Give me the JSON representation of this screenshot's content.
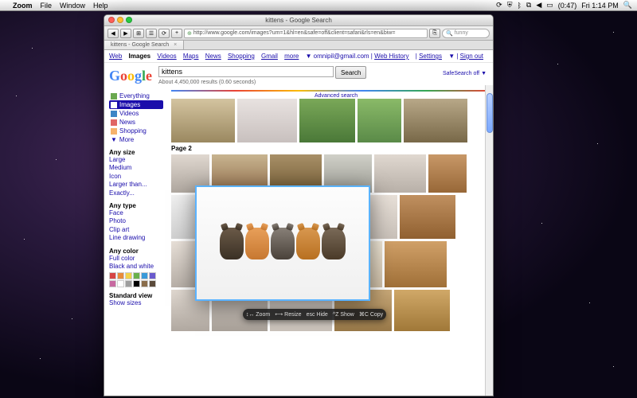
{
  "menubar": {
    "app": "Zoom",
    "items": [
      "File",
      "Window",
      "Help"
    ],
    "time": "Fri 1:14 PM",
    "battery": "(0:47)"
  },
  "browser": {
    "title": "kittens - Google Search",
    "url": "http://www.google.com/images?um=1&hl=en&safe=off&client=safari&rls=en&biw=",
    "search_placeholder": "funny",
    "tab": "kittens - Google Search"
  },
  "google": {
    "topnav": [
      "Web",
      "Images",
      "Videos",
      "Maps",
      "News",
      "Shopping",
      "Gmail",
      "more"
    ],
    "topnav_active": "Images",
    "account": "omnipil@gmail.com",
    "topright": [
      "Web History",
      "Settings",
      "Sign out"
    ],
    "query": "kittens",
    "search_btn": "Search",
    "stats": "About 4,450,000 results (0.60 seconds)",
    "advanced": "Advanced search",
    "safesearch": "SafeSearch off",
    "side_cats": [
      {
        "label": "Everything",
        "color": "#6aa84f"
      },
      {
        "label": "Images",
        "color": "#3d85c6",
        "selected": true
      },
      {
        "label": "Videos",
        "color": "#3d85c6"
      },
      {
        "label": "News",
        "color": "#e06666"
      },
      {
        "label": "Shopping",
        "color": "#f6b26b"
      },
      {
        "label": "More",
        "color": "#888"
      }
    ],
    "filters": {
      "size_h": "Any size",
      "sizes": [
        "Large",
        "Medium",
        "Icon",
        "Larger than...",
        "Exactly..."
      ],
      "type_h": "Any type",
      "types": [
        "Face",
        "Photo",
        "Clip art",
        "Line drawing"
      ],
      "color_h": "Any color",
      "colors": [
        "Full color",
        "Black and white"
      ],
      "swatches": [
        "#d64545",
        "#e88c3c",
        "#f2d34b",
        "#6ab04c",
        "#3a9ad9",
        "#6a5acd",
        "#c769a0",
        "#ffffff",
        "#9e9e9e",
        "#000000",
        "#8a6d4b",
        "#5a4a3a"
      ],
      "view_h": "Standard view",
      "view_opt": "Show sizes"
    },
    "page2": "Page 2"
  },
  "zoom_toolbar": {
    "zoom": "Zoom",
    "resize": "Resize",
    "hide": "esc Hide",
    "show": "^Z Show",
    "copy": "⌘C Copy"
  }
}
